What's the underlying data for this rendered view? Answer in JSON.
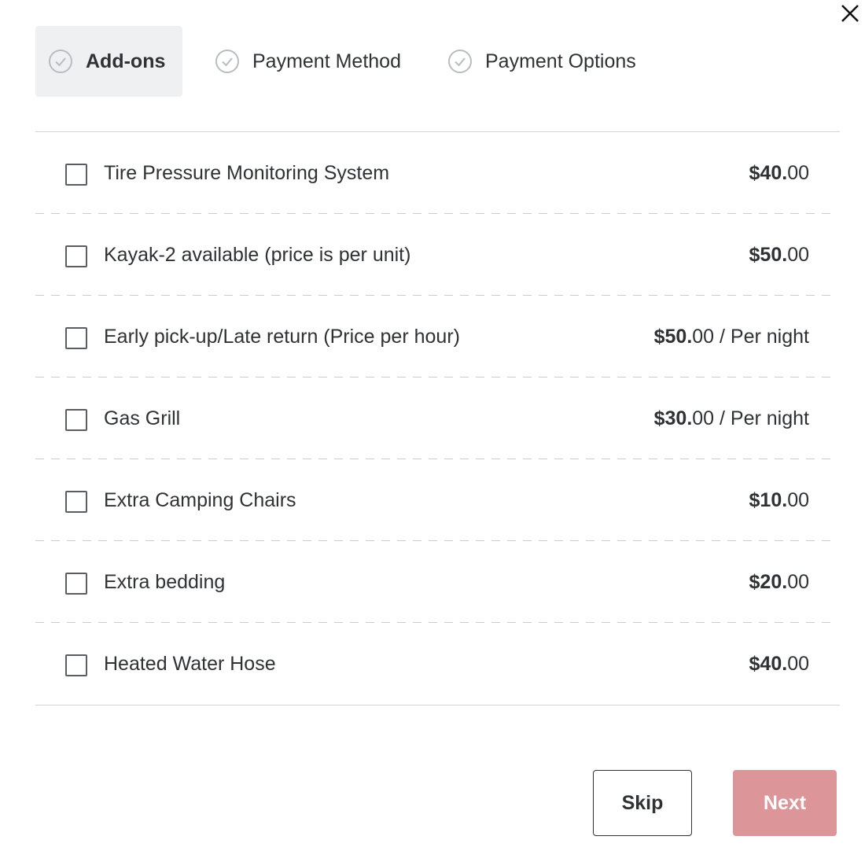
{
  "colors": {
    "active_step_bg": "#eef0f2",
    "next_button_bg": "#dc9599",
    "text": "#2f3135"
  },
  "close": {
    "icon": "close-icon"
  },
  "steps": [
    {
      "label": "Add-ons",
      "icon": "check-circle-icon",
      "active": true
    },
    {
      "label": "Payment Method",
      "icon": "check-circle-icon",
      "active": false
    },
    {
      "label": "Payment Options",
      "icon": "check-circle-icon",
      "active": false
    }
  ],
  "addons": [
    {
      "label": "Tire Pressure Monitoring System",
      "price_bold": "$40.",
      "price_cents": "00",
      "suffix": "",
      "checked": false
    },
    {
      "label": "Kayak-2 available (price is per unit)",
      "price_bold": "$50.",
      "price_cents": "00",
      "suffix": "",
      "checked": false
    },
    {
      "label": "Early pick-up/Late return (Price per hour)",
      "price_bold": "$50.",
      "price_cents": "00",
      "suffix": " / Per night",
      "checked": false
    },
    {
      "label": "Gas Grill",
      "price_bold": "$30.",
      "price_cents": "00",
      "suffix": " / Per night",
      "checked": false
    },
    {
      "label": "Extra Camping Chairs",
      "price_bold": "$10.",
      "price_cents": "00",
      "suffix": "",
      "checked": false
    },
    {
      "label": "Extra bedding",
      "price_bold": "$20.",
      "price_cents": "00",
      "suffix": "",
      "checked": false
    },
    {
      "label": "Heated Water Hose",
      "price_bold": "$40.",
      "price_cents": "00",
      "suffix": "",
      "checked": false
    }
  ],
  "footer": {
    "skip_label": "Skip",
    "next_label": "Next"
  }
}
